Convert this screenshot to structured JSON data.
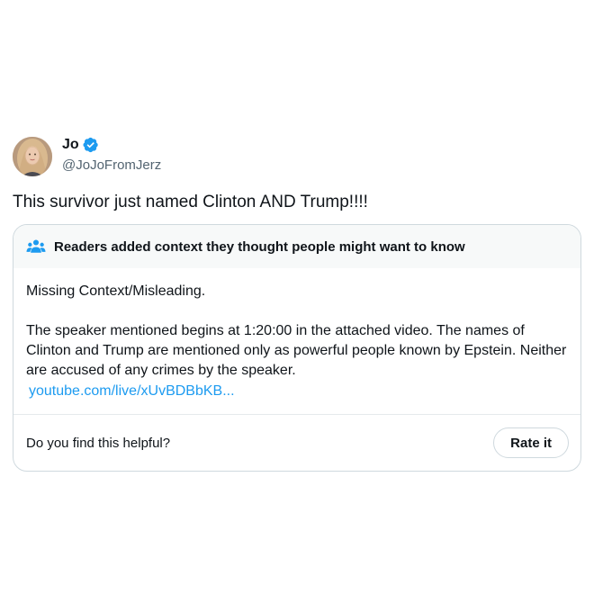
{
  "author": {
    "display_name": "Jo",
    "handle": "@JoJoFromJerz",
    "verified_icon": "verified-badge-icon",
    "avatar": "user-avatar"
  },
  "tweet": {
    "text": "This survivor just named Clinton AND Trump!!!!"
  },
  "community_note": {
    "icon": "people-icon",
    "title": "Readers added context they thought people might want to know",
    "summary": "Missing Context/Misleading.",
    "body": "The speaker mentioned begins at 1:20:00 in the attached video. The names of Clinton and Trump are mentioned only as powerful people known by Epstein. Neither are accused of any crimes by the speaker.",
    "link": "youtube.com/live/xUvBDBbKB...",
    "question": "Do you find this helpful?",
    "rate_label": "Rate it"
  },
  "colors": {
    "accent": "#1d9bf0",
    "text": "#0f1419",
    "muted": "#536471",
    "border": "#cfd9de",
    "note_header_bg": "#f7f9f9"
  }
}
